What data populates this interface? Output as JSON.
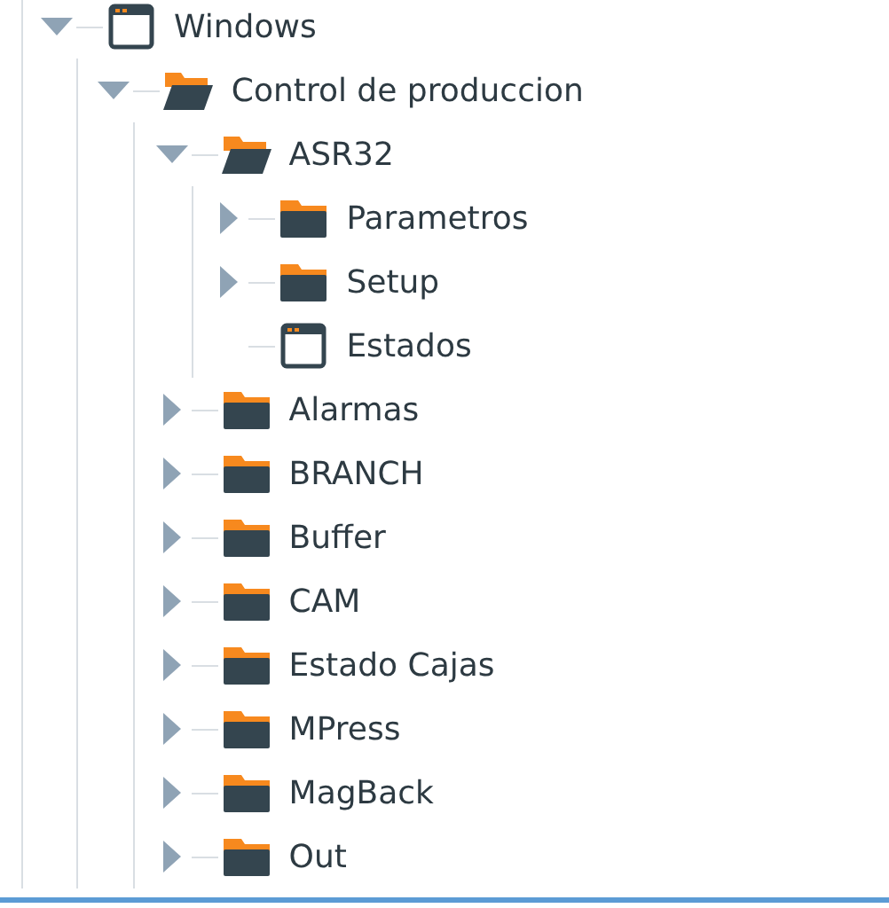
{
  "tree": [
    {
      "label": "Windows",
      "kind": "window",
      "expanded": true,
      "children": [
        {
          "label": "Control de produccion",
          "kind": "folder",
          "expanded": true,
          "children": [
            {
              "label": "ASR32",
              "kind": "folder",
              "expanded": true,
              "children": [
                {
                  "label": "Parametros",
                  "kind": "folder",
                  "expanded": false
                },
                {
                  "label": "Setup",
                  "kind": "folder",
                  "expanded": false
                },
                {
                  "label": "Estados",
                  "kind": "window"
                }
              ]
            },
            {
              "label": "Alarmas",
              "kind": "folder",
              "expanded": false
            },
            {
              "label": "BRANCH",
              "kind": "folder",
              "expanded": false
            },
            {
              "label": "Buffer",
              "kind": "folder",
              "expanded": false
            },
            {
              "label": "CAM",
              "kind": "folder",
              "expanded": false
            },
            {
              "label": "Estado Cajas",
              "kind": "folder",
              "expanded": false
            },
            {
              "label": "MPress",
              "kind": "folder",
              "expanded": false
            },
            {
              "label": "MagBack",
              "kind": "folder",
              "expanded": false
            },
            {
              "label": "Out",
              "kind": "folder",
              "expanded": false
            }
          ]
        }
      ]
    }
  ]
}
